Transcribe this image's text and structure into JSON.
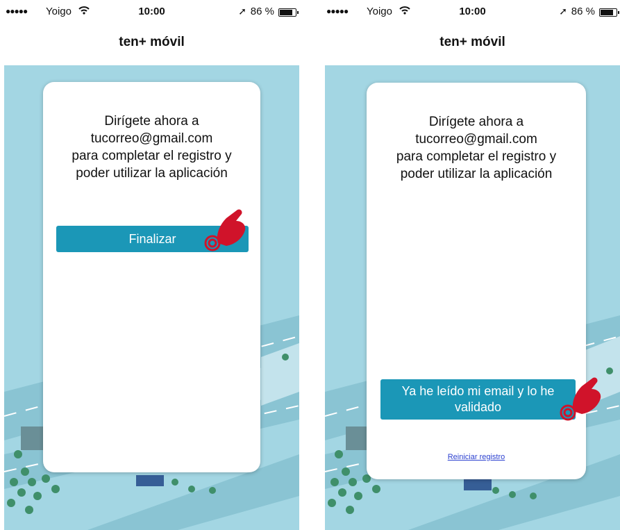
{
  "left_screen": {
    "status": {
      "signal": "●●●●●",
      "carrier": "Yoigo",
      "time": "10:00",
      "location_arrow": "➚",
      "battery_pct": "86 %"
    },
    "nav_title": "ten+ móvil",
    "message_lines": [
      "Dirígete ahora a",
      "tucorreo@gmail.com",
      "para completar el registro y",
      "poder utilizar la aplicación"
    ],
    "finalize_label": "Finalizar"
  },
  "right_screen": {
    "status": {
      "signal": "●●●●●",
      "carrier": "Yoigo",
      "time": "10:00",
      "location_arrow": "➚",
      "battery_pct": "86 %"
    },
    "nav_title": "ten+ móvil",
    "message_lines": [
      "Dirígete ahora a",
      "tucorreo@gmail.com",
      "para completar el registro y",
      "poder utilizar la aplicación"
    ],
    "validated_label_lines": [
      "Ya he leído mi email y lo he",
      "validado"
    ],
    "restart_link": "Reiniciar registro"
  },
  "colors": {
    "accent_button": "#1b97b7",
    "background": "#a3d6e3",
    "hand_pointer": "#d0132a",
    "link": "#2a3fcf"
  },
  "icons": [
    "wifi-icon",
    "location-arrow-icon",
    "battery-icon",
    "tap-hand-icon"
  ]
}
